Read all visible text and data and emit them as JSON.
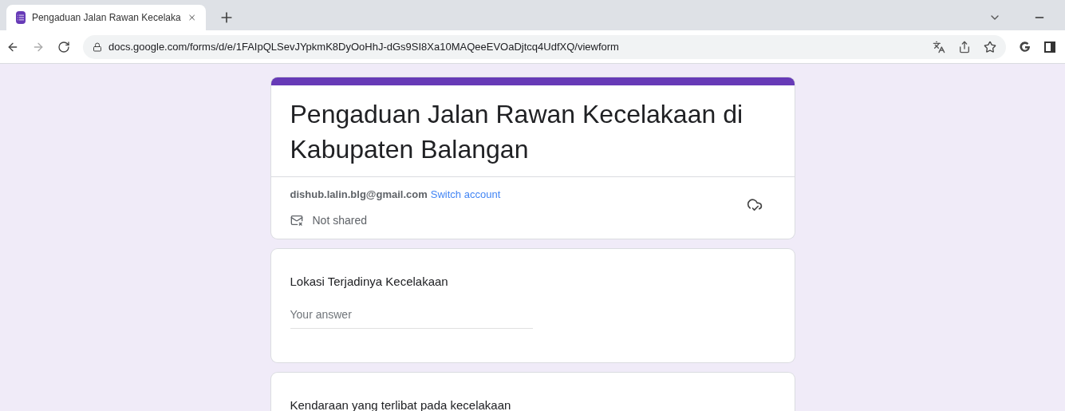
{
  "browser": {
    "tab": {
      "title": "Pengaduan Jalan Rawan Kecelaka",
      "selected": true
    },
    "address": "docs.google.com/forms/d/e/1FAIpQLSevJYpkmK8DyOoHhJ-dGs9SI8Xa10MAQeeEVOaDjtcq4UdfXQ/viewform"
  },
  "form": {
    "title": "Pengaduan Jalan Rawan Kecelakaan di Kabupaten Balangan",
    "account": "dishub.lalin.blg@gmail.com",
    "switch_link": "Switch account",
    "sharing": "Not shared",
    "questions": [
      {
        "label": "Lokasi Terjadinya Kecelakaan",
        "placeholder": "Your answer"
      },
      {
        "label": "Kendaraan yang terlibat pada kecelakaan"
      }
    ]
  }
}
